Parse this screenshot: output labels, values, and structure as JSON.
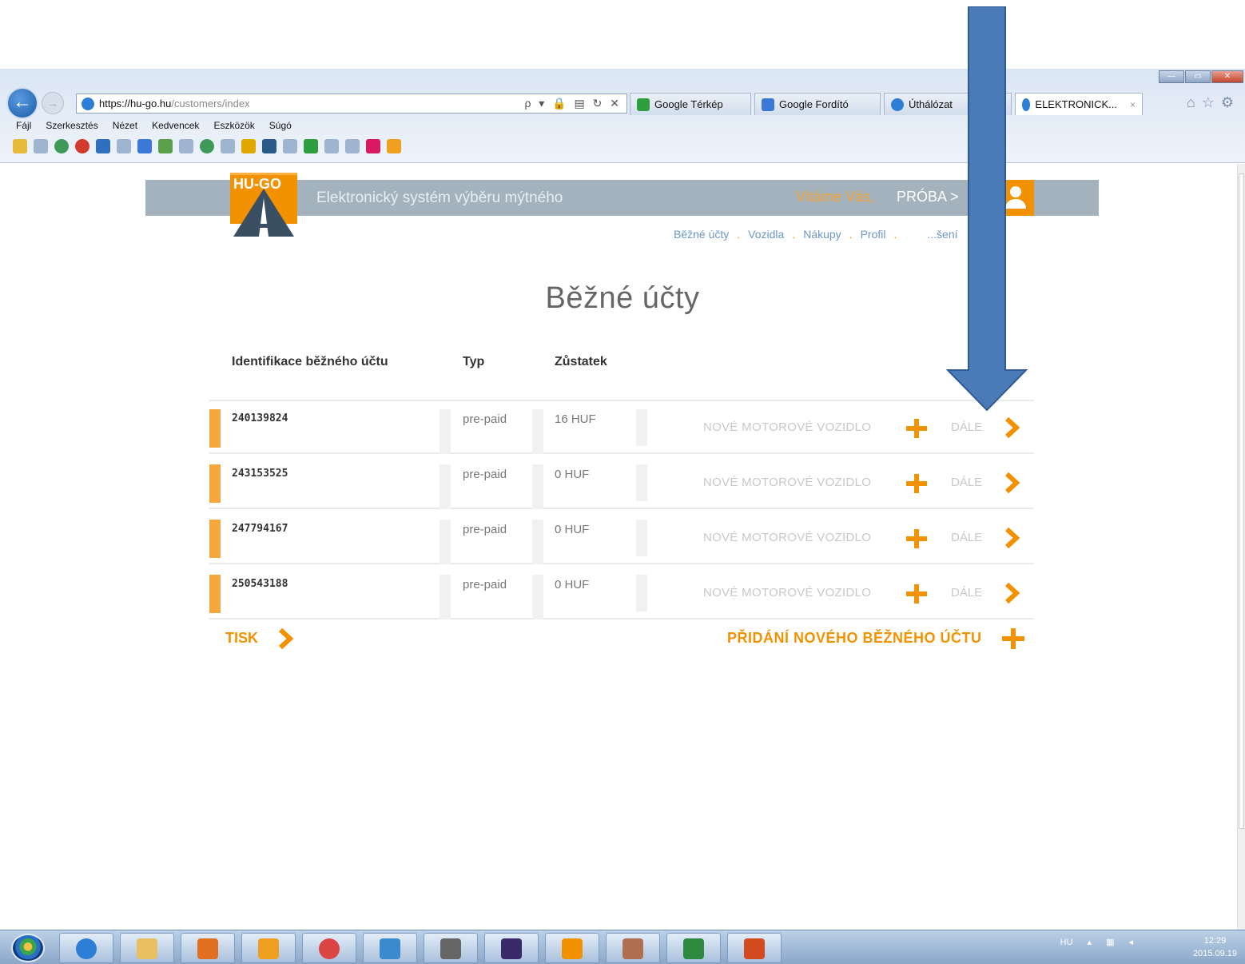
{
  "browser": {
    "address_host": "https://hu-go.hu",
    "address_path": "/customers/index",
    "address_tools": "ρ ▾ 🔒 ▤ ↻ ✕",
    "tabs": [
      {
        "label": "Google Térkép",
        "color": "#2e9e3e"
      },
      {
        "label": "Google Fordító",
        "color": "#3b78d8"
      },
      {
        "label": "Úthálózat",
        "color": "#2d7fd6"
      },
      {
        "label": "ELEKTRONICK...",
        "color": "#2d7fd6",
        "active": true,
        "close": "×"
      }
    ],
    "menu": [
      "Fájl",
      "Szerkesztés",
      "Nézet",
      "Kedvencek",
      "Eszközök",
      "Súgó"
    ]
  },
  "header": {
    "logo_text": "HU-GO",
    "title": "Elektronický systém výběru mýtného",
    "welcome": "Vítáme Vás,",
    "user": "PRÓBA >"
  },
  "nav": {
    "items": [
      "Běžné účty",
      "Vozidla",
      "Nákupy",
      "Profil",
      "...šení"
    ],
    "separator": "."
  },
  "page_title": "Běžné účty",
  "table": {
    "headers": {
      "id": "Identifikace běžného účtu",
      "type": "Typ",
      "balance": "Zůstatek"
    },
    "rows": [
      {
        "id": "240139824",
        "type": "pre-paid",
        "balance": "16 HUF",
        "new_vehicle": "NOVÉ MOTOROVÉ VOZIDLO",
        "next": "DÁLE"
      },
      {
        "id": "243153525",
        "type": "pre-paid",
        "balance": "0 HUF",
        "new_vehicle": "NOVÉ MOTOROVÉ VOZIDLO",
        "next": "DÁLE"
      },
      {
        "id": "247794167",
        "type": "pre-paid",
        "balance": "0 HUF",
        "new_vehicle": "NOVÉ MOTOROVÉ VOZIDLO",
        "next": "DÁLE"
      },
      {
        "id": "250543188",
        "type": "pre-paid",
        "balance": "0 HUF",
        "new_vehicle": "NOVÉ MOTOROVÉ VOZIDLO",
        "next": "DÁLE"
      }
    ]
  },
  "actions": {
    "print": "TISK",
    "add_account": "PŘIDÁNÍ NOVÉHO BĚŽNÉHO ÚČTU"
  },
  "taskbar": {
    "lang": "HU",
    "time": "12:29",
    "date": "2015.09.19"
  },
  "colors": {
    "accent": "#f39200",
    "header_bar": "#a3b2bd",
    "annotation_arrow": "#4a7ab8"
  }
}
